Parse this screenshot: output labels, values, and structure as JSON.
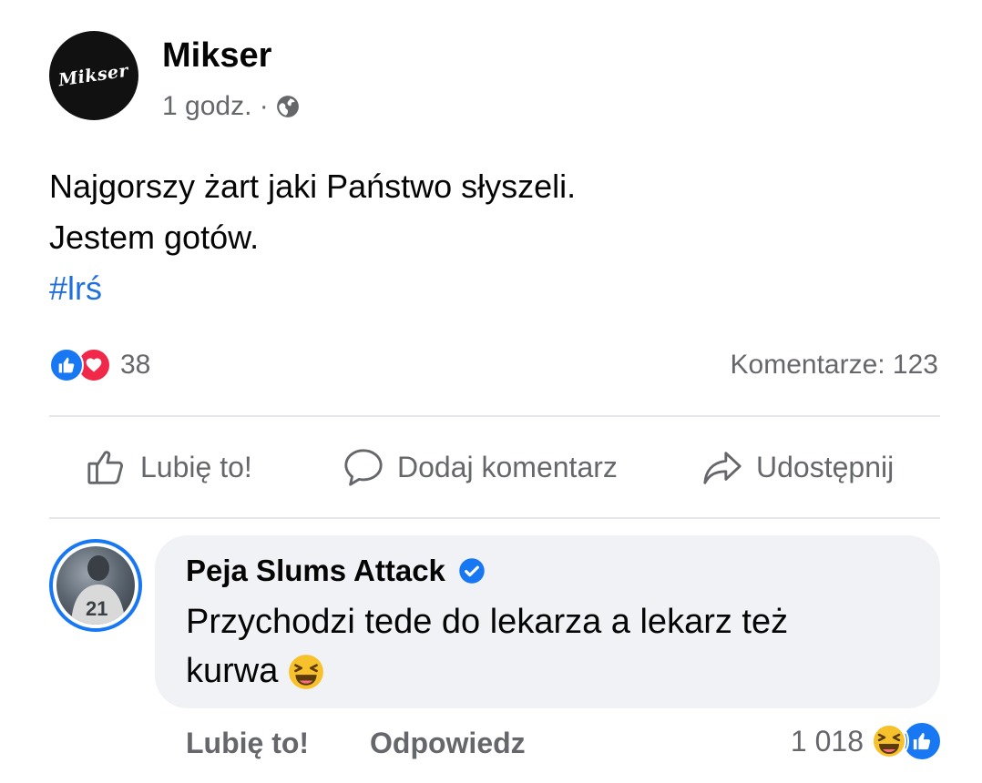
{
  "post": {
    "author": "Mikser",
    "avatar_text": "Mikser",
    "time": "1 godz. ·",
    "text_line1": "Najgorszy żart jaki Państwo słyszeli.",
    "text_line2": "Jestem gotów.",
    "hashtag": "#lrś"
  },
  "stats": {
    "reactions_count": "38",
    "comments": "Komentarze: 123"
  },
  "actions": {
    "like": "Lubię to!",
    "comment": "Dodaj komentarz",
    "share": "Udostępnij"
  },
  "comment": {
    "author": "Peja Slums Attack",
    "text_line1": "Przychodzi tede do lekarza a lekarz też",
    "text_line2": "kurwa",
    "like": "Lubię to!",
    "reply": "Odpowiedz",
    "reactions_count": "1 018"
  },
  "colors": {
    "link_blue": "#216fdb",
    "facebook_blue": "#1877f2",
    "love_red": "#f02849",
    "muted_gray": "#65676b",
    "bubble_bg": "#f0f2f5"
  },
  "icons": [
    "globe-icon",
    "like-reaction-icon",
    "love-reaction-icon",
    "thumbs-up-icon",
    "comment-icon",
    "share-icon",
    "verified-icon",
    "laughing-emoji-icon",
    "haha-reaction-icon"
  ]
}
